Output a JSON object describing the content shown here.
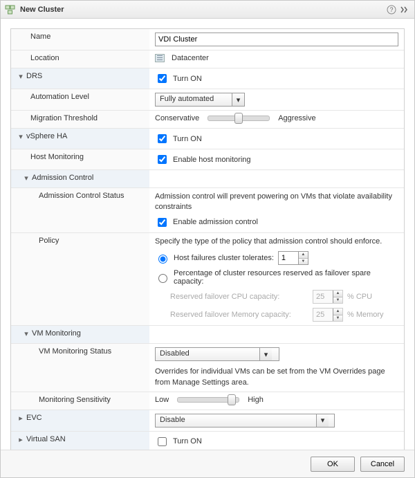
{
  "dialog": {
    "title": "New Cluster"
  },
  "fields": {
    "name": {
      "label": "Name",
      "value": "VDI Cluster"
    },
    "location": {
      "label": "Location",
      "value": "Datacenter"
    },
    "drs": {
      "label": "DRS",
      "turn_on": "Turn ON",
      "checked": true
    },
    "automation_level": {
      "label": "Automation Level",
      "value": "Fully automated"
    },
    "migration_threshold": {
      "label": "Migration Threshold",
      "left": "Conservative",
      "right": "Aggressive"
    },
    "vsphere_ha": {
      "label": "vSphere HA",
      "turn_on": "Turn ON",
      "checked": true
    },
    "host_monitoring": {
      "label": "Host Monitoring",
      "text": "Enable host monitoring",
      "checked": true
    },
    "admission_control": {
      "label": "Admission Control"
    },
    "admission_status": {
      "label": "Admission Control Status",
      "desc": "Admission control will prevent powering on VMs that violate availability constraints",
      "text": "Enable admission control",
      "checked": true
    },
    "policy": {
      "label": "Policy",
      "desc": "Specify the type of the policy that admission control should enforce.",
      "opt1": "Host failures cluster tolerates:",
      "opt1_value": "1",
      "opt2": "Percentage of cluster resources reserved as failover spare capacity:",
      "cpu_label": "Reserved failover CPU capacity:",
      "cpu_value": "25",
      "cpu_unit": "%  CPU",
      "mem_label": "Reserved failover Memory capacity:",
      "mem_value": "25",
      "mem_unit": "%  Memory"
    },
    "vm_monitoring": {
      "label": "VM Monitoring"
    },
    "vm_monitoring_status": {
      "label": "VM Monitoring Status",
      "value": "Disabled",
      "desc": "Overrides for individual VMs can be set from the VM Overrides page from Manage Settings area."
    },
    "monitoring_sensitivity": {
      "label": "Monitoring Sensitivity",
      "left": "Low",
      "right": "High"
    },
    "evc": {
      "label": "EVC",
      "value": "Disable"
    },
    "vsan": {
      "label": "Virtual SAN",
      "turn_on": "Turn ON",
      "checked": false
    }
  },
  "buttons": {
    "ok": "OK",
    "cancel": "Cancel"
  }
}
